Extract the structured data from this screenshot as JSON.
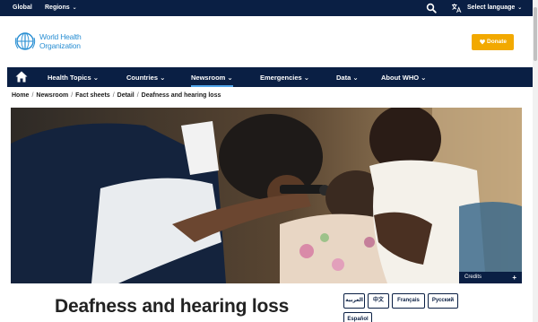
{
  "topbar": {
    "global_label": "Global",
    "regions_label": "Regions",
    "language_label": "Select language"
  },
  "header": {
    "logo_line1": "World Health",
    "logo_line2": "Organization",
    "donate_label": "Donate"
  },
  "nav": {
    "items": [
      {
        "label": "Health Topics"
      },
      {
        "label": "Countries"
      },
      {
        "label": "Newsroom"
      },
      {
        "label": "Emergencies"
      },
      {
        "label": "Data"
      },
      {
        "label": "About WHO"
      }
    ],
    "active_item": "Newsroom"
  },
  "breadcrumb": [
    "Home",
    "Newsroom",
    "Fact sheets",
    "Detail",
    "Deafness and hearing loss"
  ],
  "hero": {
    "credits_label": "Credits",
    "credits_plus": "+"
  },
  "article": {
    "title": "Deafness and hearing loss"
  },
  "languages": [
    "العربية",
    "中文",
    "Français",
    "Русский",
    "Español"
  ],
  "colors": {
    "navy": "#0a1f44",
    "accent_blue": "#4fa3e8",
    "logo_blue": "#2a8fd3",
    "donate": "#f2a900"
  },
  "icons": [
    "home-icon",
    "search-icon",
    "translate-icon",
    "heart-icon",
    "chevron-down-icon",
    "who-emblem-icon"
  ]
}
